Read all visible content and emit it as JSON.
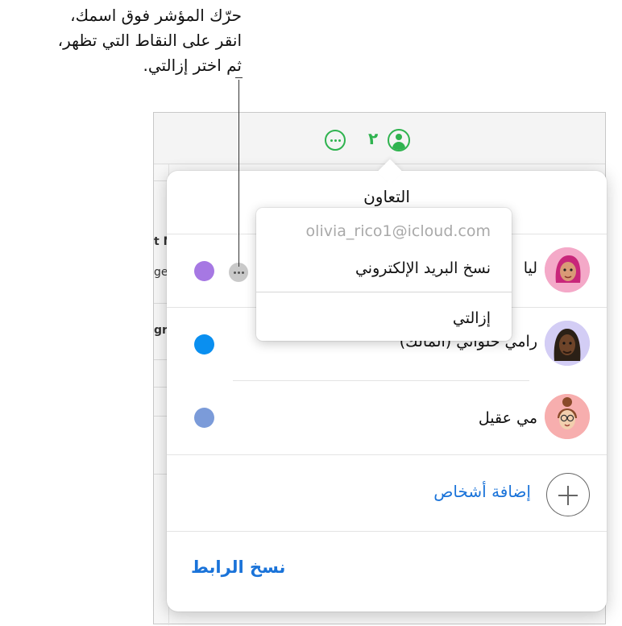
{
  "callout": {
    "line1": "حرّك المؤشر فوق اسمك،",
    "line2": "انقر على النقاط التي تظهر،",
    "line3": "ثم اختر إزالتي."
  },
  "toolbar": {
    "more_icon": "ellipsis-circle-icon",
    "collaborator_count": "٢",
    "collaborator_icon": "person-circle-icon",
    "accent_color": "#2fb34f"
  },
  "sheet": {
    "frag1": "t N",
    "frag2": "ge",
    "frag3": "gr"
  },
  "popover": {
    "title": "التعاون",
    "people": [
      {
        "name": "ليا",
        "color": "#a678e3",
        "avatar": "memoji-pink-hair-avatar"
      },
      {
        "name": "رامي حلواني (المالك)",
        "color": "#0a8ff0",
        "avatar": "memoji-dreadlocks-avatar"
      },
      {
        "name": "مي عقيل",
        "color": "#7b9bd9",
        "avatar": "memoji-bun-glasses-avatar"
      }
    ],
    "add_people": "إضافة أشخاص",
    "copy_link": "نسخ الرابط",
    "link_color": "#1a73d9"
  },
  "menu": {
    "email": "olivia_rico1@icloud.com",
    "copy_email": "نسخ البريد الإلكتروني",
    "remove_me": "إزالتي"
  }
}
